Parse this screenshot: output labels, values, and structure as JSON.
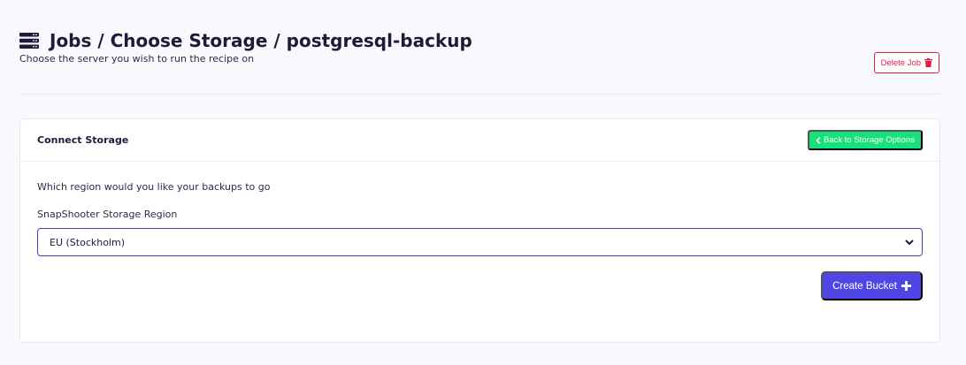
{
  "header": {
    "title": "Jobs / Choose Storage / postgresql-backup",
    "subtitle": "Choose the server you wish to run the recipe on",
    "icon": "server-icon",
    "delete_label": "Delete Job",
    "delete_icon": "trash-icon",
    "delete_color": "#e11d48"
  },
  "card": {
    "title": "Connect Storage",
    "back_label": "Back to Storage Options",
    "back_icon": "chevron-left-icon",
    "back_color": "#16e17a",
    "question": "Which region would you like your backups to go",
    "region_label": "SnapShooter Storage Region",
    "region_value": "EU (Stockholm)",
    "create_label": "Create Bucket",
    "create_icon": "plus-icon",
    "create_color": "#4f46e5"
  }
}
